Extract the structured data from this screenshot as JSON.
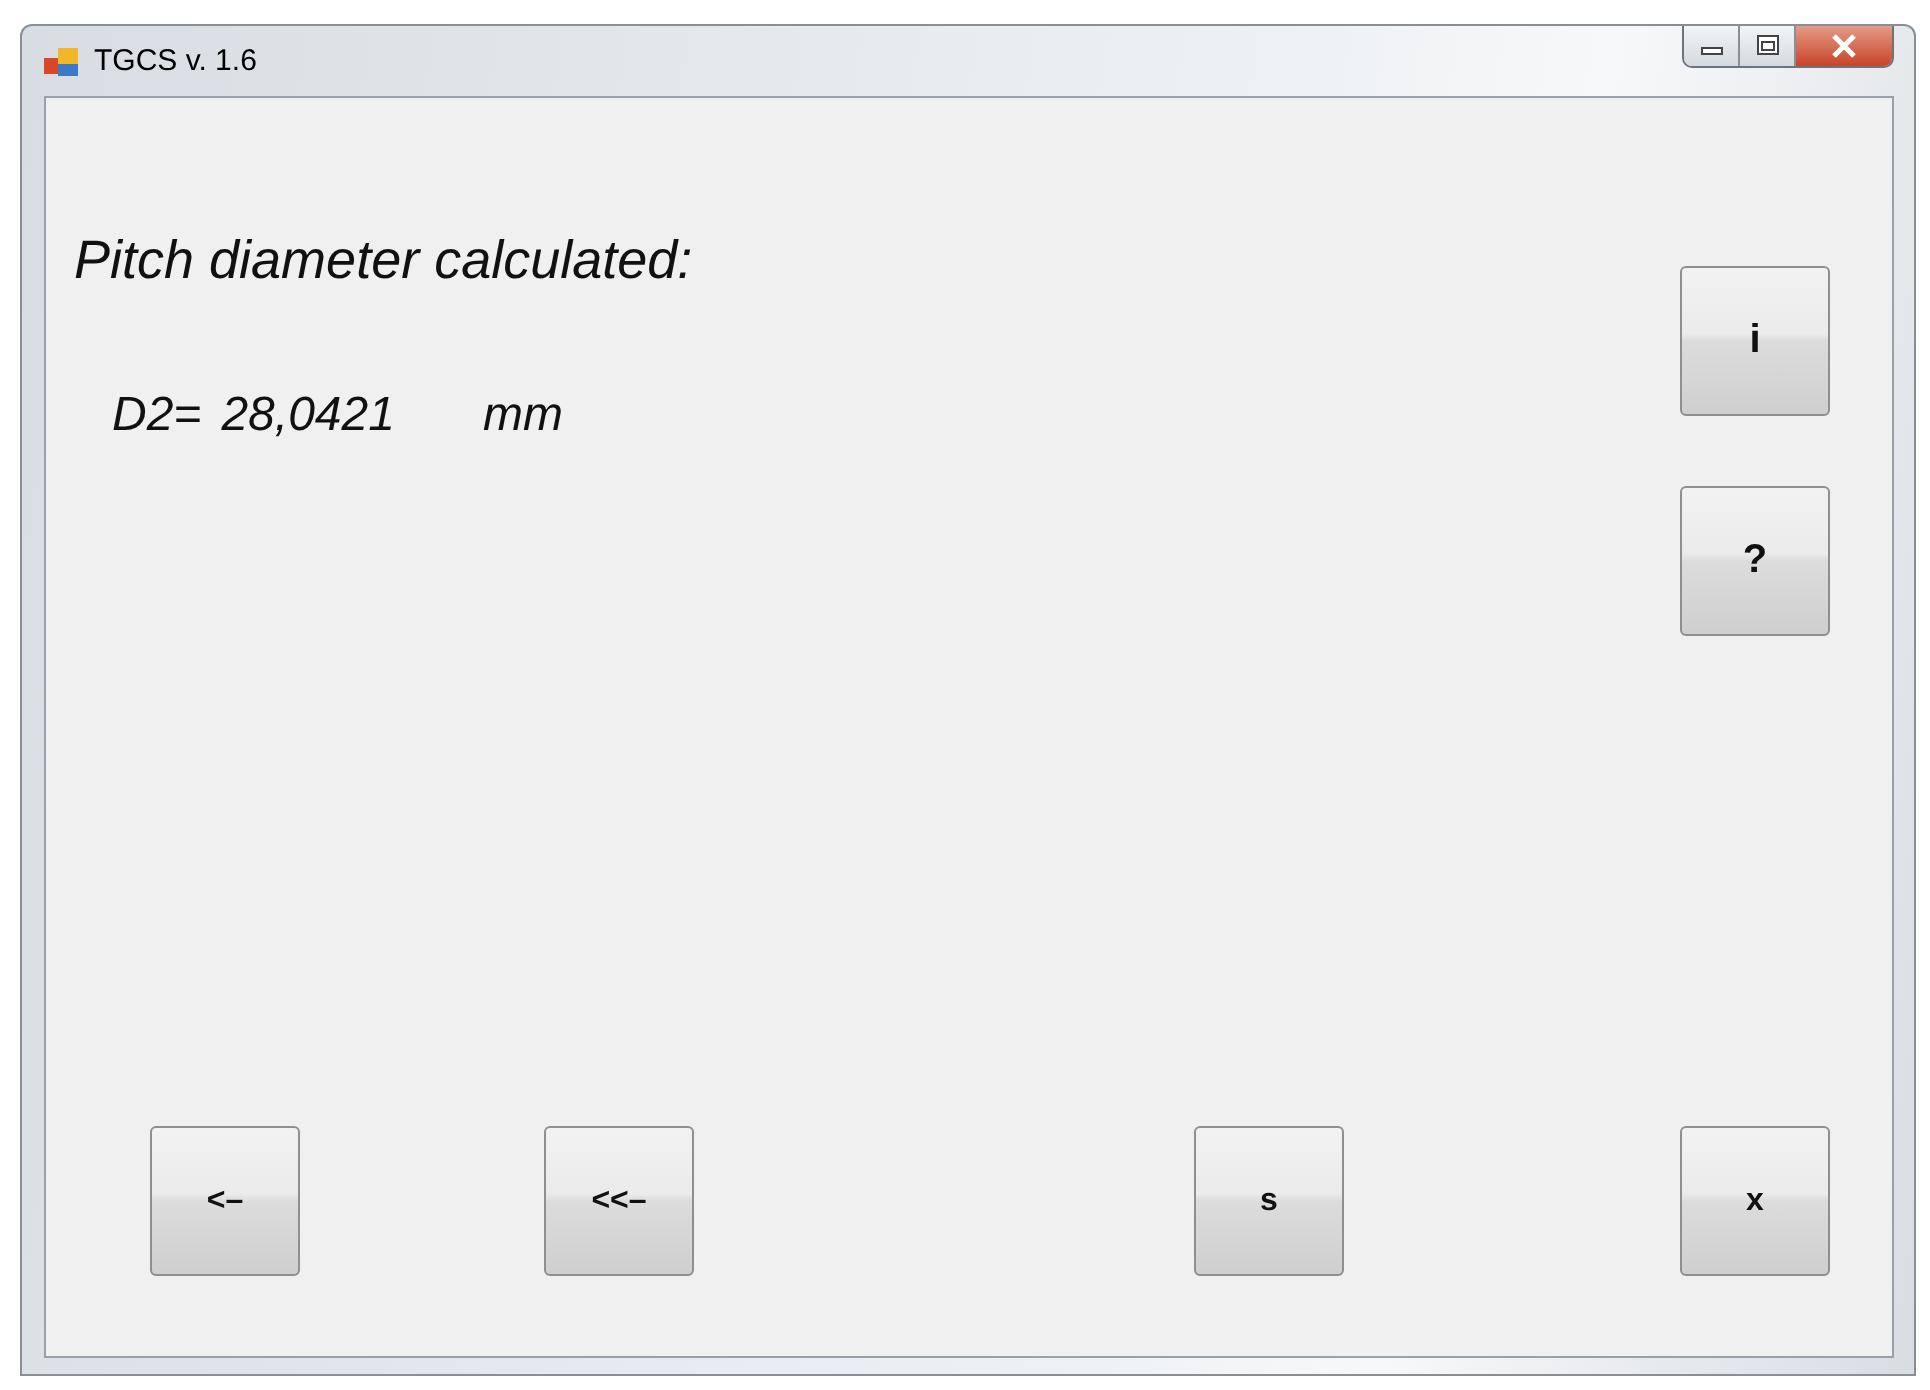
{
  "window": {
    "title": "TGCS v. 1.6"
  },
  "heading": "Pitch diameter calculated:",
  "result": {
    "label": "D2=",
    "value": "28,0421",
    "unit": "mm"
  },
  "side_buttons": [
    {
      "label": "i"
    },
    {
      "label": "?"
    }
  ],
  "bottom_buttons": [
    {
      "label": "<–"
    },
    {
      "label": "<<–"
    },
    {
      "label": "s"
    },
    {
      "label": "x"
    }
  ]
}
